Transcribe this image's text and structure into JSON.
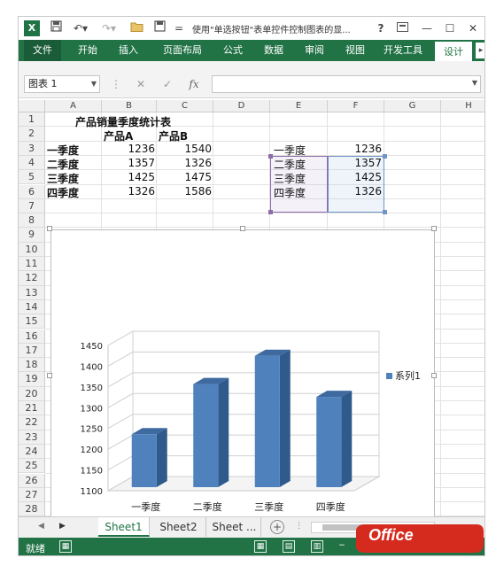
{
  "app": {
    "title": "使用\"单选按钮\"表单控件控制图表的显...",
    "help": "?",
    "icon_label": "X"
  },
  "ribbon": {
    "tabs": [
      "文件",
      "开始",
      "插入",
      "页面布局",
      "公式",
      "数据",
      "审阅",
      "视图",
      "开发工具",
      "设计"
    ]
  },
  "formula_bar": {
    "name_box": "图表 1",
    "fx": "fx",
    "value": ""
  },
  "columns": [
    "A",
    "B",
    "C",
    "D",
    "E",
    "F",
    "G",
    "H"
  ],
  "rows": [
    "1",
    "2",
    "3",
    "4",
    "5",
    "6",
    "7",
    "8",
    "9",
    "10",
    "11",
    "12",
    "13",
    "14",
    "15",
    "16",
    "17",
    "18",
    "19",
    "20",
    "21",
    "22",
    "23",
    "24",
    "25",
    "26",
    "27",
    "28"
  ],
  "table": {
    "title": "产品销量季度统计表",
    "headers": [
      "产品A",
      "产品B"
    ],
    "rows": [
      {
        "quarter": "一季度",
        "a": "1236",
        "b": "1540"
      },
      {
        "quarter": "二季度",
        "a": "1357",
        "b": "1326"
      },
      {
        "quarter": "三季度",
        "a": "1425",
        "b": "1475"
      },
      {
        "quarter": "四季度",
        "a": "1326",
        "b": "1586"
      }
    ]
  },
  "helper": {
    "rows": [
      {
        "e": "一季度",
        "f": "1236"
      },
      {
        "e": "二季度",
        "f": "1357"
      },
      {
        "e": "三季度",
        "f": "1425"
      },
      {
        "e": "四季度",
        "f": "1326"
      }
    ]
  },
  "chart_data": {
    "type": "bar",
    "categories": [
      "一季度",
      "二季度",
      "三季度",
      "四季度"
    ],
    "series": [
      {
        "name": "系列1",
        "values": [
          1236,
          1357,
          1425,
          1326
        ]
      }
    ],
    "ylim": [
      1100,
      1450
    ],
    "yticks": [
      1100,
      1150,
      1200,
      1250,
      1300,
      1350,
      1400,
      1450
    ],
    "grid": true,
    "legend": "right",
    "color": "#4f81bd",
    "style": "3d"
  },
  "sheets": [
    "Sheet1",
    "Sheet2",
    "Sheet ..."
  ],
  "status": {
    "text": "就绪"
  },
  "watermark": "Office"
}
